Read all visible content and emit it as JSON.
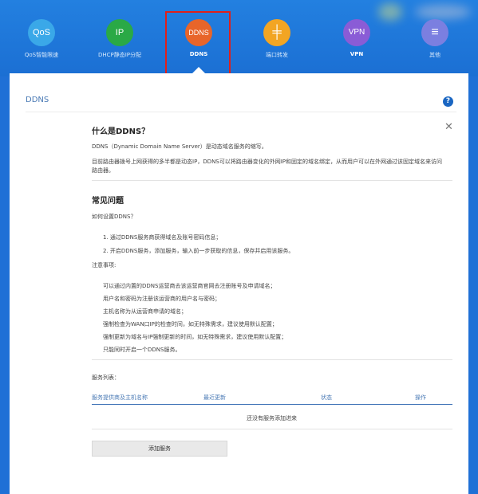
{
  "nav": [
    {
      "id": "qos",
      "icon_text": "QoS",
      "label": "QoS智能限速",
      "color": "#3aa8e8",
      "icon_name": "qos-icon"
    },
    {
      "id": "dhcp",
      "icon_text": "IP",
      "label": "DHCP静态IP分配",
      "color": "#2aa946",
      "icon_name": "ip-icon"
    },
    {
      "id": "ddns",
      "icon_text": "DDNS",
      "label": "DDNS",
      "color": "#e8652a",
      "icon_name": "ddns-icon",
      "active": true
    },
    {
      "id": "port",
      "icon_text": "╪",
      "label": "端口转发",
      "color": "#f2a523",
      "icon_name": "port-forward-icon"
    },
    {
      "id": "vpn",
      "icon_text": "VPN",
      "label": "VPN",
      "color": "#8a5cd6",
      "icon_name": "vpn-icon"
    },
    {
      "id": "other",
      "icon_text": "≡",
      "label": "其他",
      "color": "#7b7fe0",
      "icon_name": "menu-icon"
    }
  ],
  "page": {
    "header": "DDNS",
    "help": "?",
    "close": "✕"
  },
  "intro": {
    "title": "什么是DDNS？",
    "line1": "DDNS（Dynamic Domain Name Server）是动态域名服务的缩写。",
    "line2a": "目前路由器拨号上网获得的多半都是动态IP，DDNS可以将路由器变化的外网IP和固定的域名绑定，从而用户可以在外网通过该固定域名来访问",
    "line2b": "路由器。"
  },
  "faq": {
    "title": "常见问题",
    "question": "如何设置DDNS？",
    "steps": [
      "1. 通过DDNS服务商获得域名及账号密码信息；",
      "2. 开启DDNS服务，添加服务，输入前一步获取的信息，保存并启用该服务。"
    ],
    "notes_title": "注意事项:",
    "notes": [
      "可以通过内置的DDNS运营商去该运营商官网去注册账号及申请域名；",
      "用户名和密码为注册该运营商的用户名与密码；",
      "主机名称为从运营商申请的域名；",
      "强制检查为WAN口IP的检查时间，如无特殊需求，建议使用默认配置；",
      "强制更新为域名与IP强制更新的时间，如无特殊需求，建议使用默认配置；",
      "只能同时开启一个DDNS服务。"
    ]
  },
  "service": {
    "list_title": "服务列表：",
    "columns": [
      "服务提供商及主机名称",
      "最近更新",
      "状态",
      "操作"
    ],
    "empty": "还没有服务添加进来",
    "add_button": "添加服务"
  }
}
